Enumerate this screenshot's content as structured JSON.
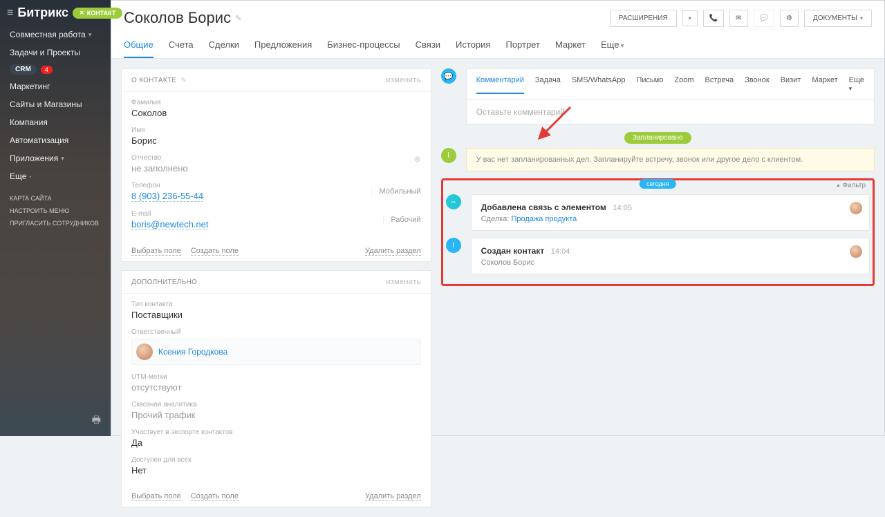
{
  "sidebar": {
    "brand": "Битрикс",
    "contact_badge": "КОНТАКТ",
    "items": [
      "Совместная работа",
      "Задачи и Проекты"
    ],
    "crm_label": "CRM",
    "crm_count": "4",
    "items2": [
      "Маркетинг",
      "Сайты и Магазины",
      "Компания",
      "Автоматизация",
      "Приложения",
      "Еще ·"
    ],
    "footer": [
      "КАРТА САЙТА",
      "НАСТРОИТЬ МЕНЮ",
      "ПРИГЛАСИТЬ СОТРУДНИКОВ"
    ]
  },
  "header": {
    "title": "Соколов  Борис",
    "extensions": "РАСШИРЕНИЯ",
    "documents": "ДОКУМЕНТЫ"
  },
  "tabs": [
    "Общие",
    "Счета",
    "Сделки",
    "Предложения",
    "Бизнес-процессы",
    "Связи",
    "История",
    "Портрет",
    "Маркет",
    "Еще"
  ],
  "about": {
    "heading": "О КОНТАКТЕ",
    "edit": "изменить",
    "lastname_label": "Фамилия",
    "lastname": "Соколов",
    "firstname_label": "Имя",
    "firstname": "Борис",
    "middlename_label": "Отчество",
    "middlename": "не заполнено",
    "phone_label": "Телефон",
    "phone": "8 (903) 236-55-44",
    "phone_type": "Мобильный",
    "email_label": "E-mail",
    "email": "boris@newtech.net",
    "email_type": "Рабочий",
    "select_field": "Выбрать поле",
    "create_field": "Создать поле",
    "delete_section": "Удалить раздел"
  },
  "extra": {
    "heading": "ДОПОЛНИТЕЛЬНО",
    "edit": "изменить",
    "type_label": "Тип контакта",
    "type": "Поставщики",
    "responsible_label": "Ответственный",
    "responsible": "Ксения Городкова",
    "utm_label": "UTM-метки",
    "utm": "отсутствуют",
    "analytics_label": "Сквозная аналитика",
    "analytics": "Прочий трафик",
    "export_label": "Участвует в экспорте контактов",
    "export": "Да",
    "public_label": "Доступен для всех",
    "public": "Нет",
    "select_field": "Выбрать поле",
    "create_field": "Создать поле",
    "delete_section": "Удалить раздел"
  },
  "activity": {
    "tabs": [
      "Комментарий",
      "Задача",
      "SMS/WhatsApp",
      "Письмо",
      "Zoom",
      "Встреча",
      "Звонок",
      "Визит",
      "Маркет",
      "Еще"
    ],
    "comment_placeholder": "Оставьте комментарий",
    "planned": "Запланировано",
    "notice": "У вас нет запланированных дел. Запланируйте встречу, звонок или другое дело с клиентом.",
    "today": "сегодня",
    "filter": "Фильтр",
    "event1_title": "Добавлена связь с элементом",
    "event1_time": "14:05",
    "event1_sub_label": "Сделка:",
    "event1_sub_link": "Продажа продукта",
    "event2_title": "Создан контакт",
    "event2_time": "14:04",
    "event2_sub": "Соколов Борис"
  }
}
